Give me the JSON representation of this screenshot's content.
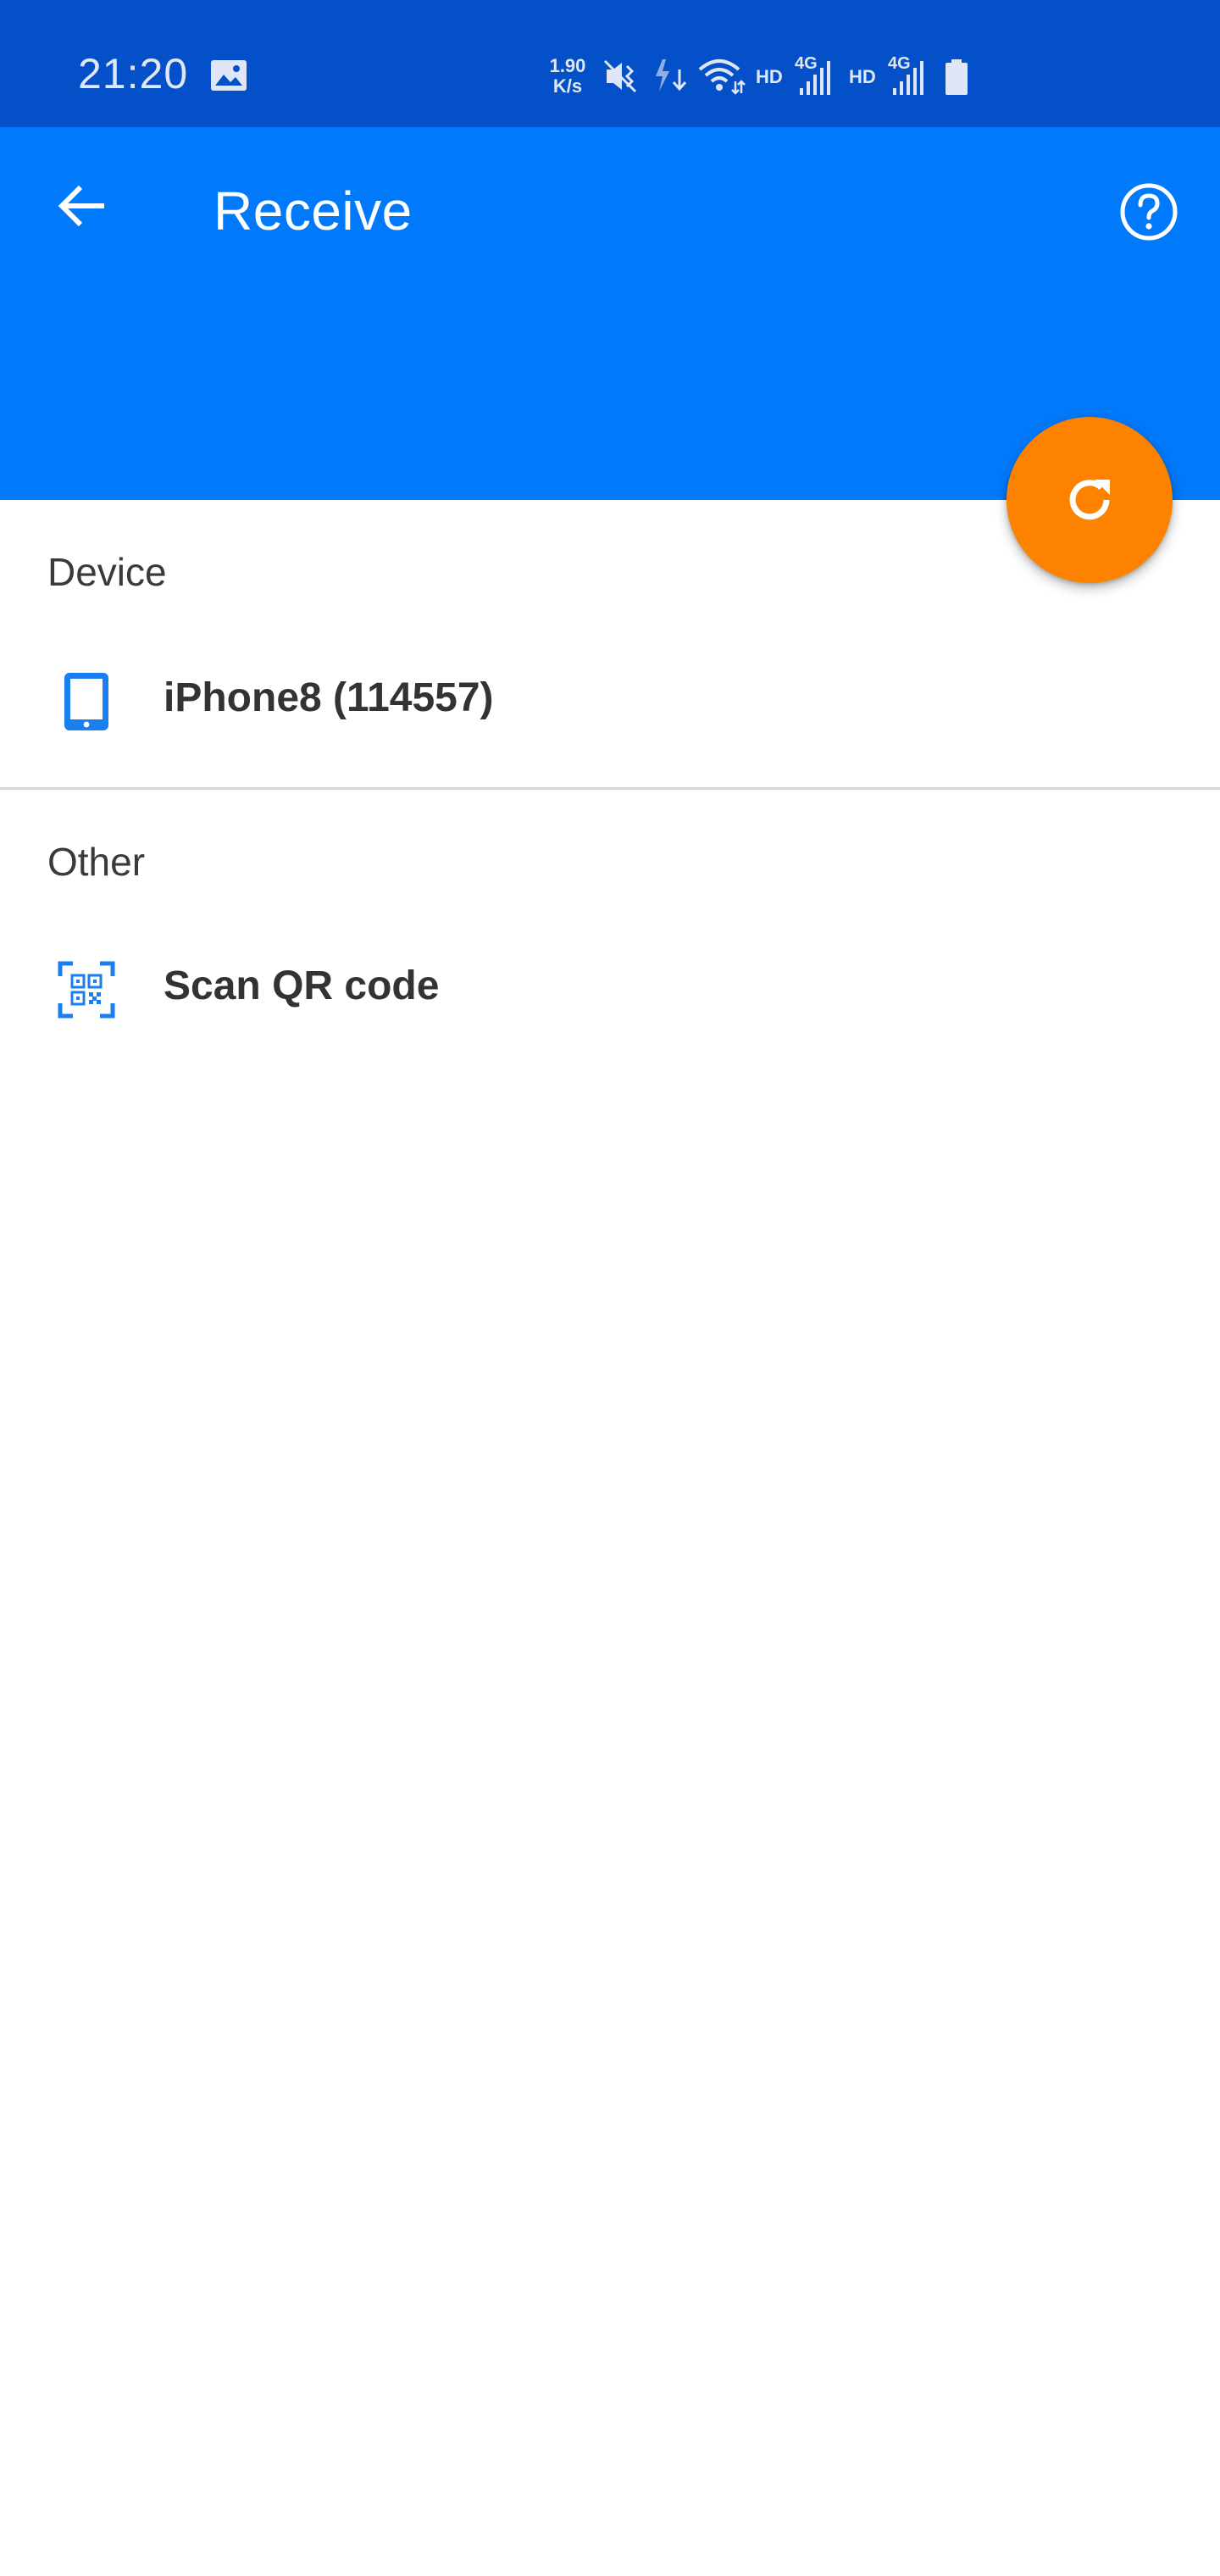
{
  "status_bar": {
    "time": "21:20",
    "net_speed_value": "1.90",
    "net_speed_unit": "K/s",
    "icons": [
      "gallery-icon",
      "vibrate-mute-icon",
      "data-arrows-icon",
      "wifi-icon",
      "hd-label",
      "4g-signal-icon",
      "hd-label",
      "4g-signal-icon",
      "battery-icon"
    ],
    "hd_label_1": "HD",
    "hd_label_2": "HD",
    "net_type_1": "4G",
    "net_type_2": "4G"
  },
  "app_bar": {
    "title": "Receive",
    "back_icon": "arrow-back-icon",
    "help_icon": "help-circle-icon"
  },
  "fab": {
    "icon": "refresh-icon"
  },
  "sections": {
    "device": {
      "header": "Device",
      "items": [
        {
          "label": "iPhone8 (114557)",
          "icon": "phone-icon"
        }
      ]
    },
    "other": {
      "header": "Other",
      "items": [
        {
          "label": "Scan QR code",
          "icon": "qr-scan-icon"
        }
      ]
    }
  },
  "colors": {
    "status_bar": "#0350c8",
    "app_bar": "#0079fa",
    "fab": "#fd8200",
    "icon_blue": "#1a7ff0",
    "text_dark": "#333333"
  }
}
